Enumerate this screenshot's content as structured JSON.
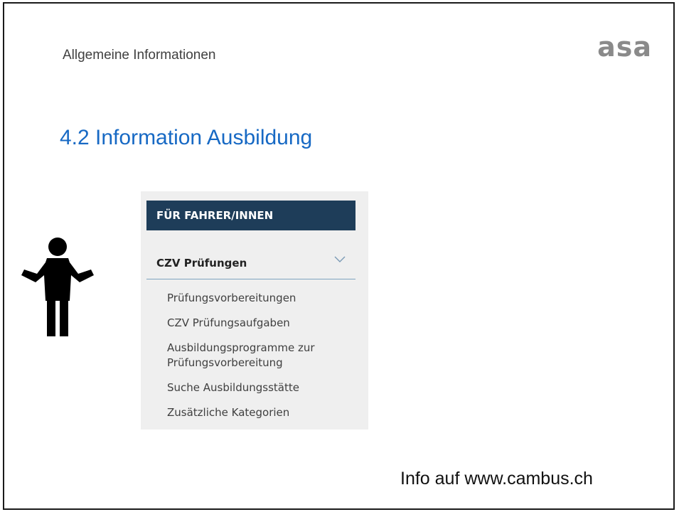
{
  "slide": {
    "section_label": "Allgemeine Informationen",
    "logo_text": "asa",
    "title": "4.2 Information Ausbildung",
    "footer": "Info auf www.cambus.ch"
  },
  "menu": {
    "header": "FÜR FAHRER/INNEN",
    "section": "CZV Prüfungen",
    "items": [
      "Prüfungsvorbereitungen",
      "CZV Prüfungsaufgaben",
      "Ausbildungsprogramme zur Prüfungsvorbereitung",
      "Suche Ausbildungsstätte",
      "Zusätzliche Kategorien"
    ]
  },
  "icons": {
    "figure": "person-shrug-icon",
    "chevron": "chevron-down-icon"
  },
  "colors": {
    "title": "#1769c4",
    "header_bg": "#1e3d59",
    "menu_bg": "#efefef",
    "logo": "#8a8a8a"
  }
}
